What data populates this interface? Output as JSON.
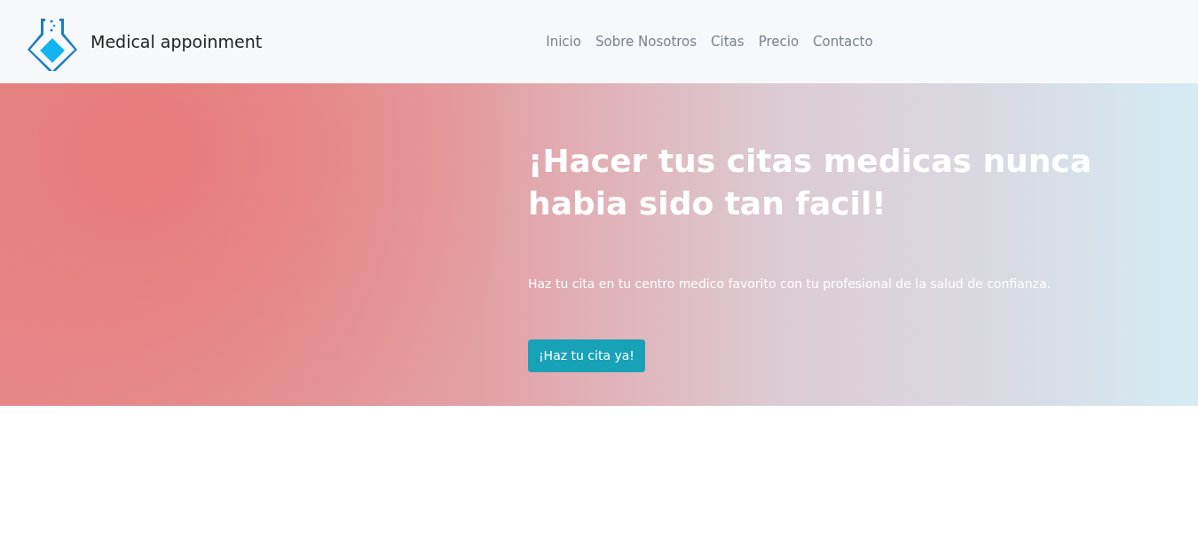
{
  "brand": {
    "name": "Medical appoinment"
  },
  "nav": [
    {
      "label": "Inicio"
    },
    {
      "label": "Sobre Nosotros"
    },
    {
      "label": "Citas"
    },
    {
      "label": "Precio"
    },
    {
      "label": "Contacto"
    }
  ],
  "hero": {
    "title": "¡Hacer tus citas medicas nunca habia sido tan facil!",
    "subtitle": "Haz tu cita en tu centro medico favorito con tu profesional de la salud de confianza.",
    "button": "¡Haz tu cita ya!"
  }
}
